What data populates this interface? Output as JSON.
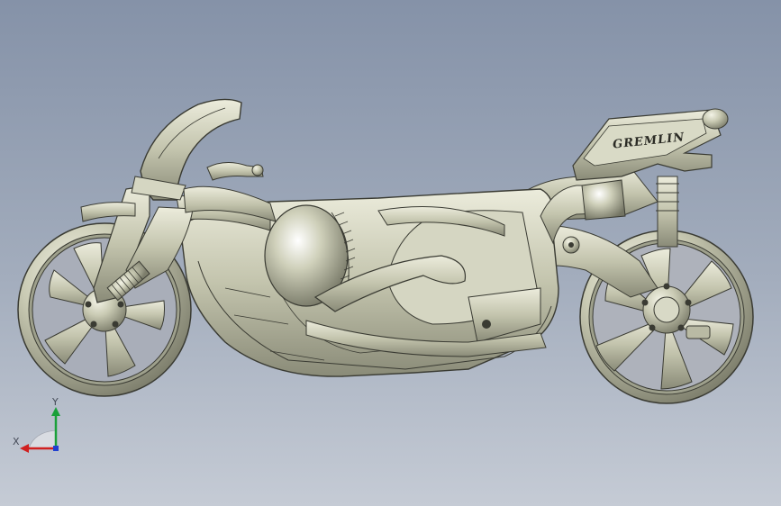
{
  "model": {
    "badge_text": "GREMLIN"
  },
  "triad": {
    "x_label": "X",
    "y_label": "Y"
  },
  "colors": {
    "background_top": "#8592a8",
    "background_bottom": "#c5cbd5",
    "model_body": "#c9cab3",
    "model_shadow": "#7d7e6c",
    "model_edge": "#3a3b33",
    "axis_x": "#d02020",
    "axis_y": "#1aa03a",
    "axis_z": "#2040d0"
  }
}
